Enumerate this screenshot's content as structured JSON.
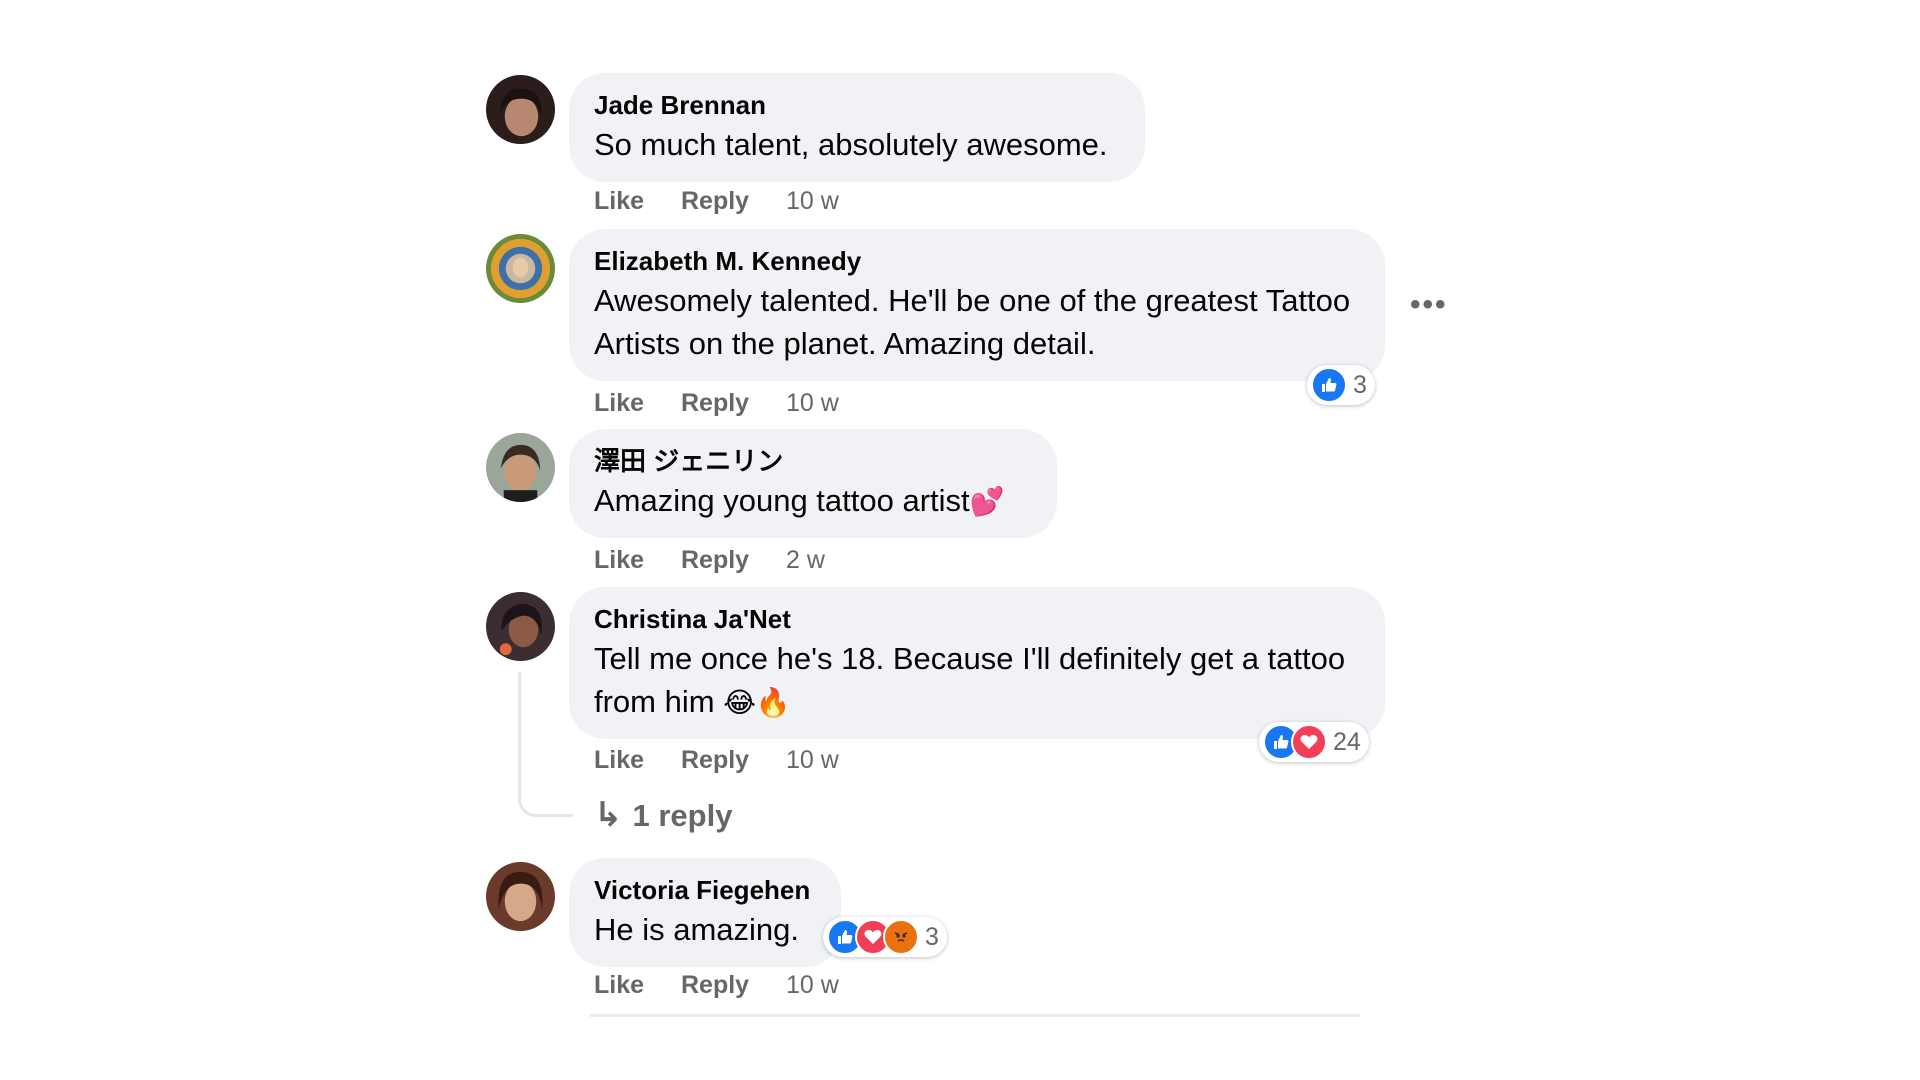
{
  "colors": {
    "bubble": "#f0f2f5",
    "meta_text": "#65676b",
    "like_blue": "#1877f2",
    "love_red": "#f33e58",
    "angry_orange": "#e9710f"
  },
  "comments": [
    {
      "author": "Jade Brennan",
      "text": "So much talent, absolutely awesome.",
      "like": "Like",
      "reply": "Reply",
      "time": "10 w"
    },
    {
      "author": "Elizabeth M. Kennedy",
      "text": "Awesomely talented. He'll be one of the greatest Tattoo Artists on the planet. Amazing detail.",
      "like": "Like",
      "reply": "Reply",
      "time": "10 w",
      "reactions": {
        "icons": [
          "like-icon"
        ],
        "count": "3"
      },
      "more_icon": "more-options-icon"
    },
    {
      "author": "澤田 ジェニリン",
      "text": "Amazing young tattoo artist",
      "emoji": "💕",
      "like": "Like",
      "reply": "Reply",
      "time": "2 w"
    },
    {
      "author": "Christina Ja'Net",
      "text": "Tell me once he's 18. Because I'll definitely get a tattoo from him",
      "emoji": "😂🔥",
      "like": "Like",
      "reply": "Reply",
      "time": "10 w",
      "reactions": {
        "icons": [
          "like-icon",
          "love-icon"
        ],
        "count": "24"
      },
      "replies_link": "1 reply",
      "replies_arrow": "↳"
    },
    {
      "author": "Victoria Fiegehen",
      "text": "He is amazing.",
      "like": "Like",
      "reply": "Reply",
      "time": "10 w",
      "reactions": {
        "icons": [
          "like-icon",
          "love-icon",
          "angry-icon"
        ],
        "count": "3"
      }
    }
  ],
  "more_dots": "•••"
}
